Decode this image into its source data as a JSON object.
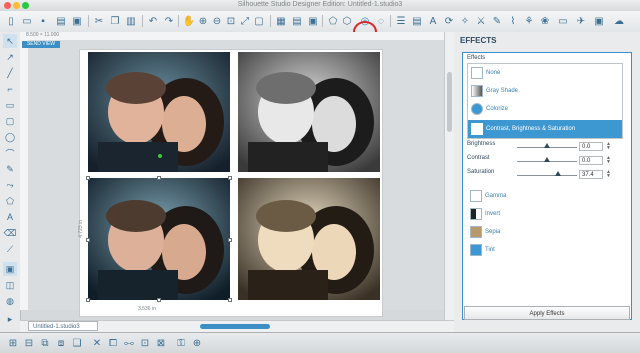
{
  "window": {
    "title": "Silhouette Studio Designer Edition: Untitled-1.studio3"
  },
  "toolbar": {
    "icons": [
      "new-icon",
      "open-icon",
      "save-icon",
      "print-icon",
      "cut-print-icon",
      "undo-icon",
      "redo-icon",
      "pan-icon",
      "zoom-in-icon",
      "zoom-out-icon",
      "zoom-select-icon",
      "zoom-fit-icon",
      "page-icon",
      "cut-settings-icon",
      "send-icon",
      "fill-icon",
      "line-icon",
      "shadow-icon",
      "image-effects-icon",
      "offset-icon",
      "align-icon",
      "replicate-icon",
      "text-icon",
      "modify-icon",
      "knife-icon",
      "eraser-icon",
      "point-edit-icon",
      "trace-icon",
      "library-icon",
      "store-icon"
    ],
    "highlighted": "image-effects-icon"
  },
  "canvas": {
    "send_tab": "SEND VIEW",
    "ruler_label": "8.500 × 11.000",
    "dim_height": "4.723 in",
    "dim_width": "3.536 in",
    "doc_tab": "Untitled-1.studio3"
  },
  "panel": {
    "header": "EFFECTS",
    "group_label": "Effects",
    "effects_top": [
      {
        "label": "None"
      },
      {
        "label": "Gray Shade"
      },
      {
        "label": "Colorize"
      },
      {
        "label": "Contrast, Brightness & Saturation"
      }
    ],
    "sliders": [
      {
        "label": "Brightness",
        "value": "0.0",
        "knob": 0.5
      },
      {
        "label": "Contrast",
        "value": "0.0",
        "knob": 0.5
      },
      {
        "label": "Saturation",
        "value": "37.4",
        "knob": 0.68
      }
    ],
    "effects_bottom": [
      {
        "label": "Gamma"
      },
      {
        "label": "Invert"
      },
      {
        "label": "Sepia"
      },
      {
        "label": "Tint"
      }
    ],
    "apply_label": "Apply Effects"
  },
  "colors": {
    "accent": "#3d97d1",
    "highlight_ring": "#d62828"
  }
}
